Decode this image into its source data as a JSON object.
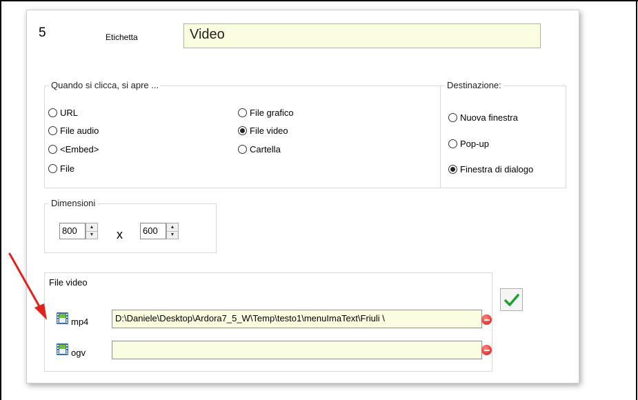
{
  "link": {
    "number": "5",
    "label_caption": "Etichetta",
    "label_value": "Video"
  },
  "open_group": {
    "title": "Quando si clicca, si apre ...",
    "options": [
      {
        "label": "URL",
        "selected": false
      },
      {
        "label": "File audio",
        "selected": false
      },
      {
        "label": "<Embed>",
        "selected": false
      },
      {
        "label": "File",
        "selected": false
      },
      {
        "label": "File grafico",
        "selected": false
      },
      {
        "label": "File video",
        "selected": true
      },
      {
        "label": "Cartella",
        "selected": false
      }
    ]
  },
  "destination_group": {
    "title": "Destinazione:",
    "options": [
      {
        "label": "Nuova finestra",
        "selected": false
      },
      {
        "label": "Pop-up",
        "selected": false
      },
      {
        "label": "Finestra di dialogo",
        "selected": true
      }
    ]
  },
  "dimensions": {
    "title": "Dimensioni",
    "width": "800",
    "separator": "x",
    "height": "600"
  },
  "video_files": {
    "title": "File video",
    "rows": [
      {
        "format": "mp4",
        "path": "D:\\Daniele\\Desktop\\Ardora7_5_W\\Temp\\testo1\\menuImaText\\Friuli \\"
      },
      {
        "format": "ogv",
        "path": ""
      }
    ]
  },
  "icons": {
    "film": "film-icon",
    "remove": "remove-icon",
    "confirm": "checkmark-icon",
    "annotation": "red-arrow"
  },
  "colors": {
    "input_bg": "#fbfde0",
    "annotation_arrow": "#e3201b",
    "confirm_check": "#1aa32a"
  }
}
